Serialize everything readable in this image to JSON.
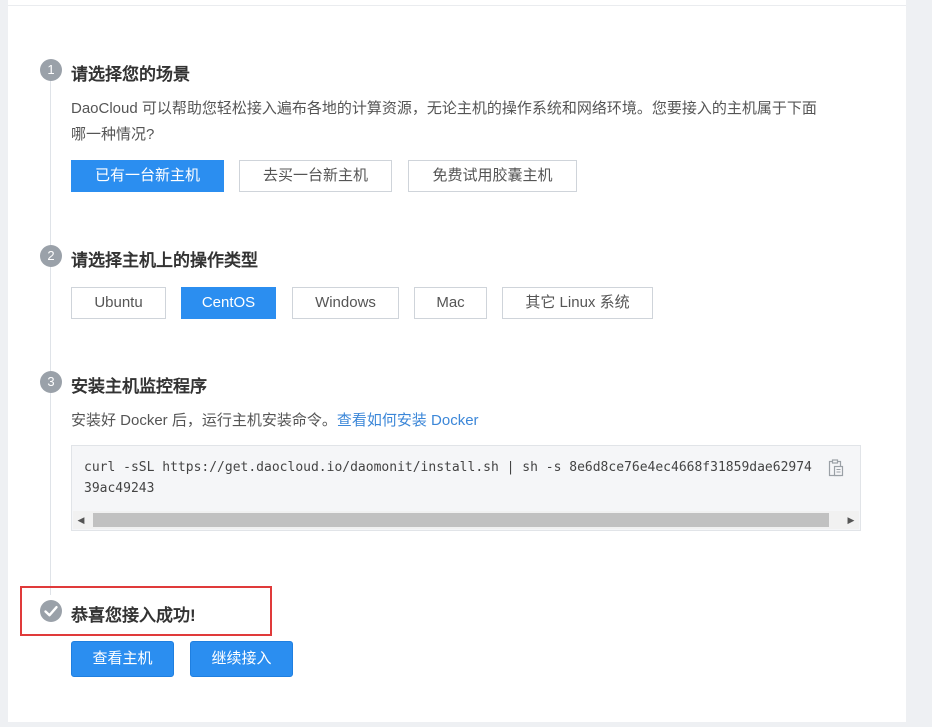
{
  "steps": [
    {
      "number": "1",
      "title": "请选择您的场景",
      "description_line1": "DaoCloud 可以帮助您轻松接入遍布各地的计算资源，无论主机的操作系统和网络环境。您要接入的主机属于下面",
      "description_line2": "哪一种情况?",
      "options": [
        "已有一台新主机",
        "去买一台新主机",
        "免费试用胶囊主机"
      ],
      "selected": "已有一台新主机"
    },
    {
      "number": "2",
      "title": "请选择主机上的操作类型",
      "options": [
        "Ubuntu",
        "CentOS",
        "Windows",
        "Mac",
        "其它 Linux 系统"
      ],
      "selected": "CentOS"
    },
    {
      "number": "3",
      "title": "安装主机监控程序",
      "description": "安装好 Docker 后，运行主机安装命令。",
      "link_text": "查看如何安装 Docker",
      "command": "curl -sSL https://get.daocloud.io/daomonit/install.sh | sh -s 8e6d8ce76e4ec4668f31859dae6297439ac49243"
    }
  ],
  "success": {
    "title": "恭喜您接入成功!",
    "buttons": [
      "查看主机",
      "继续接入"
    ]
  },
  "icons": {
    "copy": "clipboard-icon",
    "success": "check-circle-icon"
  },
  "colors": {
    "primary": "#2b8ef0",
    "link": "#3c87d8",
    "highlight": "#e03a3a",
    "step_badge": "#9aa1a9"
  }
}
